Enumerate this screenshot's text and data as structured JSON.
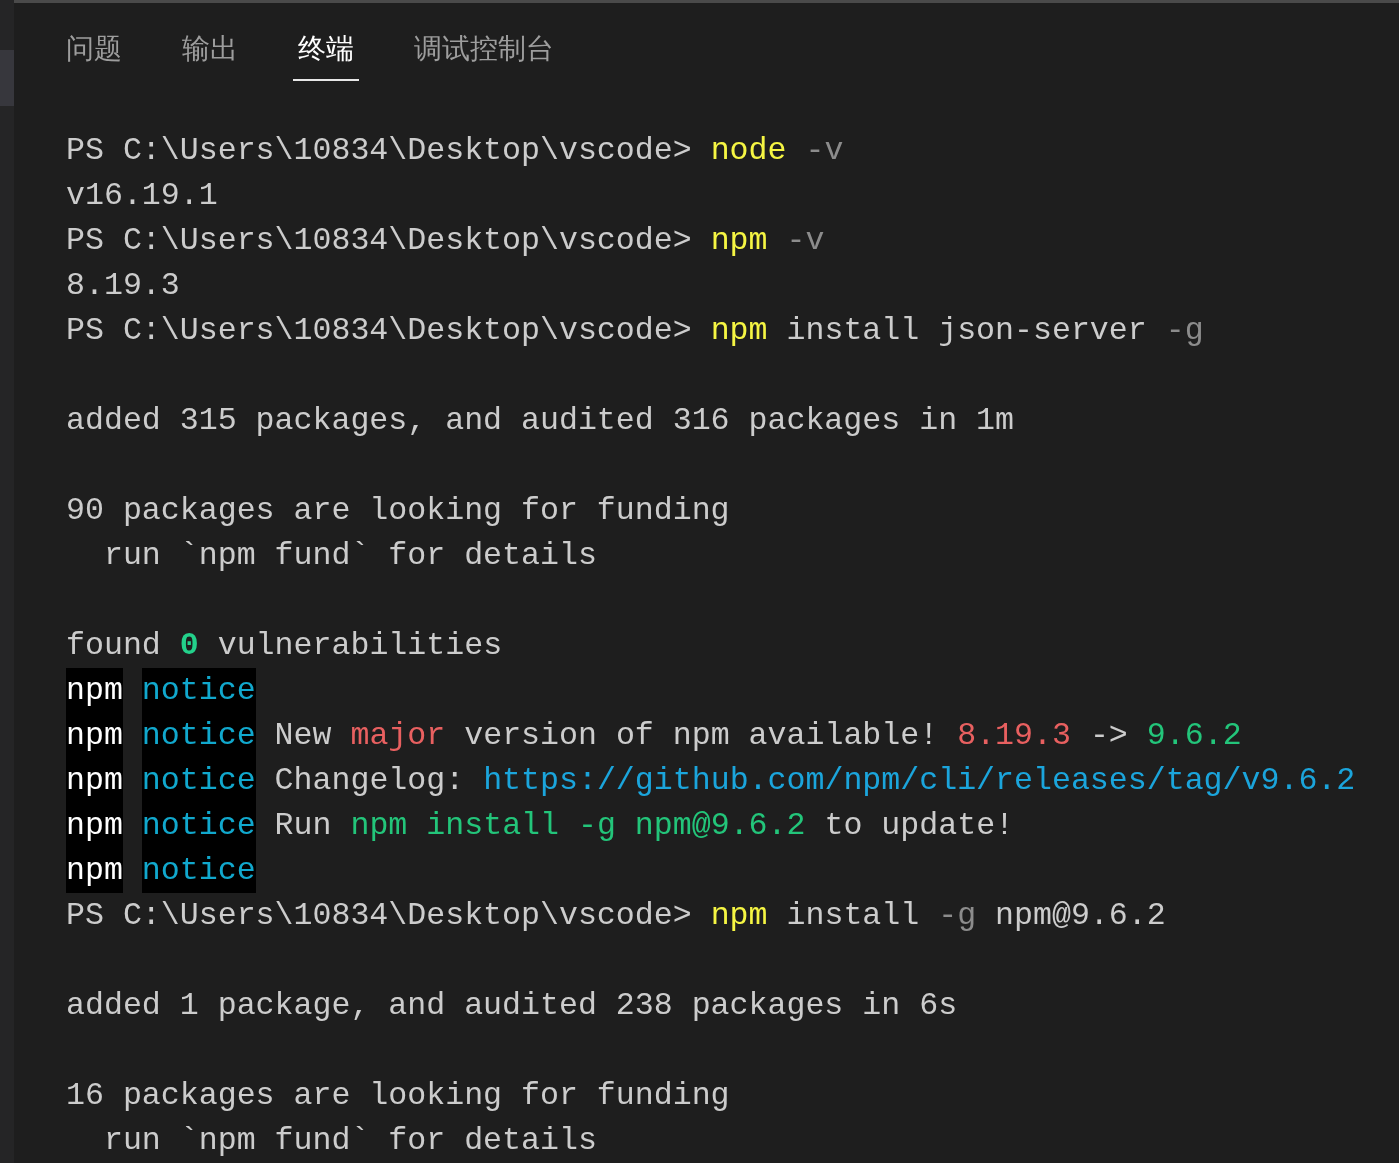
{
  "tabs": [
    {
      "label": "问题",
      "selected": false
    },
    {
      "label": "输出",
      "selected": false
    },
    {
      "label": "终端",
      "selected": true
    },
    {
      "label": "调试控制台",
      "selected": false
    }
  ],
  "terminal": {
    "lines": [
      {
        "kind": "text",
        "segments": [
          {
            "kind": "prompt",
            "text": "PS C:\\Users\\10834\\Desktop\\vscode>"
          },
          {
            "kind": "command",
            "text": "node"
          },
          {
            "kind": "option",
            "text": "-v"
          }
        ]
      },
      {
        "kind": "text",
        "segments": [
          {
            "kind": "plain",
            "text": "v16.19.1"
          }
        ]
      },
      {
        "kind": "text",
        "segments": [
          {
            "kind": "prompt",
            "text": "PS C:\\Users\\10834\\Desktop\\vscode>"
          },
          {
            "kind": "command",
            "text": "npm"
          },
          {
            "kind": "option",
            "text": "-v"
          }
        ]
      },
      {
        "kind": "text",
        "segments": [
          {
            "kind": "plain",
            "text": "8.19.3"
          }
        ]
      },
      {
        "kind": "text",
        "segments": [
          {
            "kind": "prompt",
            "text": "PS C:\\Users\\10834\\Desktop\\vscode>"
          },
          {
            "kind": "command",
            "text": "npm"
          },
          {
            "kind": "plain",
            "text": "install json-server"
          },
          {
            "kind": "option",
            "text": "-g"
          }
        ]
      },
      {
        "kind": "blank"
      },
      {
        "kind": "text",
        "segments": [
          {
            "kind": "plain",
            "text": "added 315 packages, and audited 316 packages in 1m"
          }
        ]
      },
      {
        "kind": "blank"
      },
      {
        "kind": "text",
        "segments": [
          {
            "kind": "plain",
            "text": "90 packages are looking for funding"
          }
        ]
      },
      {
        "kind": "text",
        "segments": [
          {
            "kind": "plain",
            "text": "  run `npm fund` for details"
          }
        ]
      },
      {
        "kind": "blank"
      },
      {
        "kind": "text",
        "segments": [
          {
            "kind": "plain",
            "text": "found"
          },
          {
            "kind": "success",
            "text": "0"
          },
          {
            "kind": "plain",
            "text": "vulnerabilities"
          }
        ]
      },
      {
        "kind": "text",
        "segments": [
          {
            "kind": "tag",
            "text": "npm"
          },
          {
            "kind": "level",
            "text": "notice"
          }
        ]
      },
      {
        "kind": "text",
        "segments": [
          {
            "kind": "tag",
            "text": "npm"
          },
          {
            "kind": "level",
            "text": "notice"
          },
          {
            "kind": "plain",
            "text": "New"
          },
          {
            "kind": "error",
            "text": "major"
          },
          {
            "kind": "plain",
            "text": "version of npm available!"
          },
          {
            "kind": "error",
            "text": "8.19.3"
          },
          {
            "kind": "plain",
            "text": "->"
          },
          {
            "kind": "update",
            "text": "9.6.2"
          }
        ]
      },
      {
        "kind": "text",
        "segments": [
          {
            "kind": "tag",
            "text": "npm"
          },
          {
            "kind": "level",
            "text": "notice"
          },
          {
            "kind": "plain",
            "text": "Changelog:"
          },
          {
            "kind": "link",
            "text": "https://github.com/npm/cli/releases/tag/v9.6.2"
          }
        ]
      },
      {
        "kind": "text",
        "segments": [
          {
            "kind": "tag",
            "text": "npm"
          },
          {
            "kind": "level",
            "text": "notice"
          },
          {
            "kind": "plain",
            "text": "Run"
          },
          {
            "kind": "update",
            "text": "npm install -g npm@9.6.2"
          },
          {
            "kind": "plain",
            "text": "to update!"
          }
        ]
      },
      {
        "kind": "text",
        "segments": [
          {
            "kind": "tag",
            "text": "npm"
          },
          {
            "kind": "level",
            "text": "notice"
          }
        ]
      },
      {
        "kind": "text",
        "segments": [
          {
            "kind": "prompt",
            "text": "PS C:\\Users\\10834\\Desktop\\vscode>"
          },
          {
            "kind": "command",
            "text": "npm"
          },
          {
            "kind": "plain",
            "text": "install"
          },
          {
            "kind": "option",
            "text": "-g"
          },
          {
            "kind": "plain",
            "text": "npm@9.6.2"
          }
        ]
      },
      {
        "kind": "blank"
      },
      {
        "kind": "text",
        "segments": [
          {
            "kind": "plain",
            "text": "added 1 package, and audited 238 packages in 6s"
          }
        ]
      },
      {
        "kind": "blank"
      },
      {
        "kind": "text",
        "segments": [
          {
            "kind": "plain",
            "text": "16 packages are looking for funding"
          }
        ]
      },
      {
        "kind": "text",
        "segments": [
          {
            "kind": "plain",
            "text": "  run `npm fund` for details"
          }
        ]
      }
    ]
  }
}
